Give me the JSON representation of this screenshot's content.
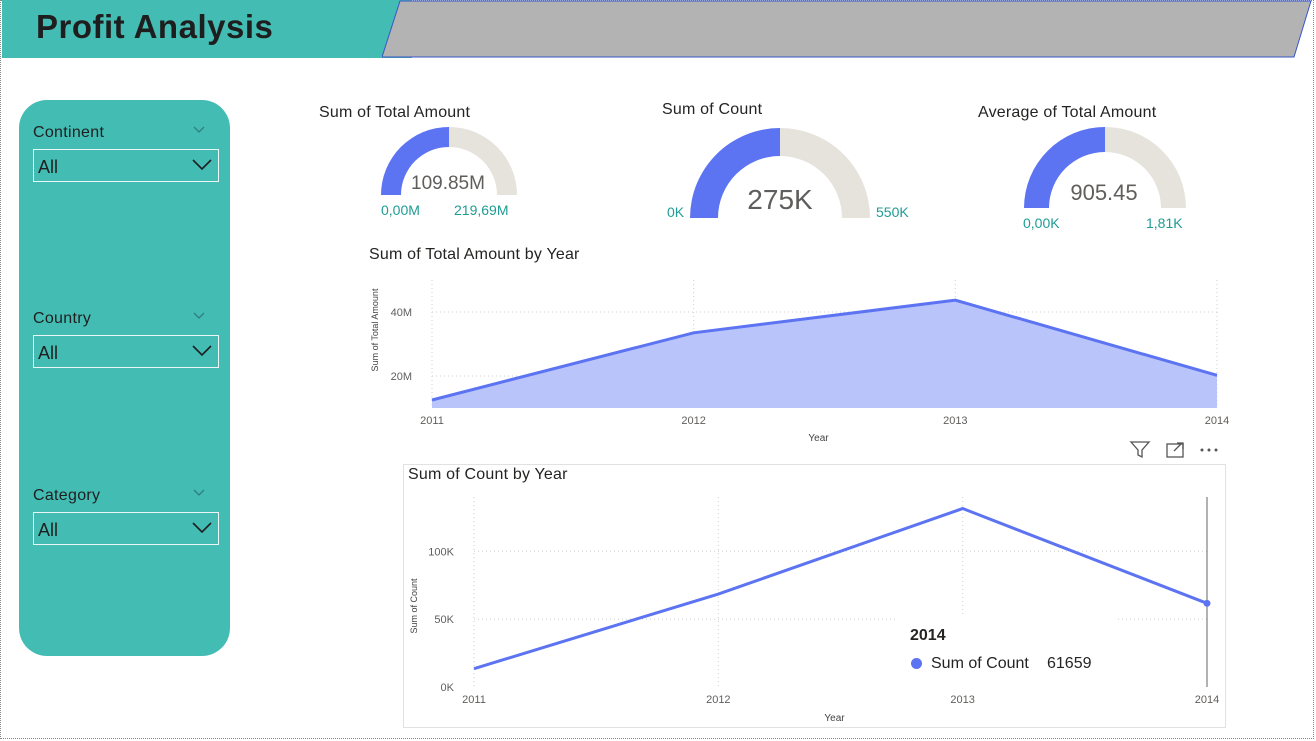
{
  "header": {
    "title": "Profit  Analysis"
  },
  "slicers": [
    {
      "label": "Continent",
      "value": "All"
    },
    {
      "label": "Country",
      "value": "All"
    },
    {
      "label": "Category",
      "value": "All"
    }
  ],
  "gauges": [
    {
      "title": "Sum of Total Amount",
      "value_label": "109.85M",
      "min_label": "0,00M",
      "max_label": "219,69M",
      "fraction": 0.5
    },
    {
      "title": "Sum of Count",
      "value_label": "275K",
      "min_label": "0K",
      "max_label": "550K",
      "fraction": 0.5
    },
    {
      "title": "Average of Total Amount",
      "value_label": "905.45",
      "min_label": "0,00K",
      "max_label": "1,81K",
      "fraction": 0.5
    }
  ],
  "colors": {
    "accent": "#5c73f2",
    "area_fill": "#b9c4fb",
    "gauge_track": "#e6e3dd",
    "teal": "#43bcb4",
    "gray_band": "#b3b3b3",
    "gauge_labels": "#1f9c94"
  },
  "icons": [
    "chevron-down-icon",
    "filter-icon",
    "focus-mode-icon",
    "more-options-icon"
  ],
  "chart_data": [
    {
      "type": "area",
      "title": "Sum of Total Amount by Year",
      "xlabel": "Year",
      "ylabel": "Sum of Total Amount",
      "x": [
        "2011",
        "2012",
        "2013",
        "2014"
      ],
      "series": [
        {
          "values": [
            12500000,
            33500000,
            43700000,
            20200000
          ]
        }
      ],
      "yticks": [
        "20M",
        "40M"
      ],
      "ylim": [
        10000000,
        50000000
      ],
      "grid": true
    },
    {
      "type": "line",
      "title": "Sum of Count by Year",
      "xlabel": "Year",
      "ylabel": "Sum of Count",
      "x": [
        "2011",
        "2012",
        "2013",
        "2014"
      ],
      "series": [
        {
          "name": "Sum of Count",
          "values": [
            13500,
            68500,
            131500,
            61659
          ]
        }
      ],
      "yticks": [
        "0K",
        "50K",
        "100K"
      ],
      "ylim": [
        0,
        140000
      ],
      "grid": true,
      "tooltip": {
        "year": "2014",
        "label": "Sum of Count",
        "value": "61659"
      }
    }
  ]
}
